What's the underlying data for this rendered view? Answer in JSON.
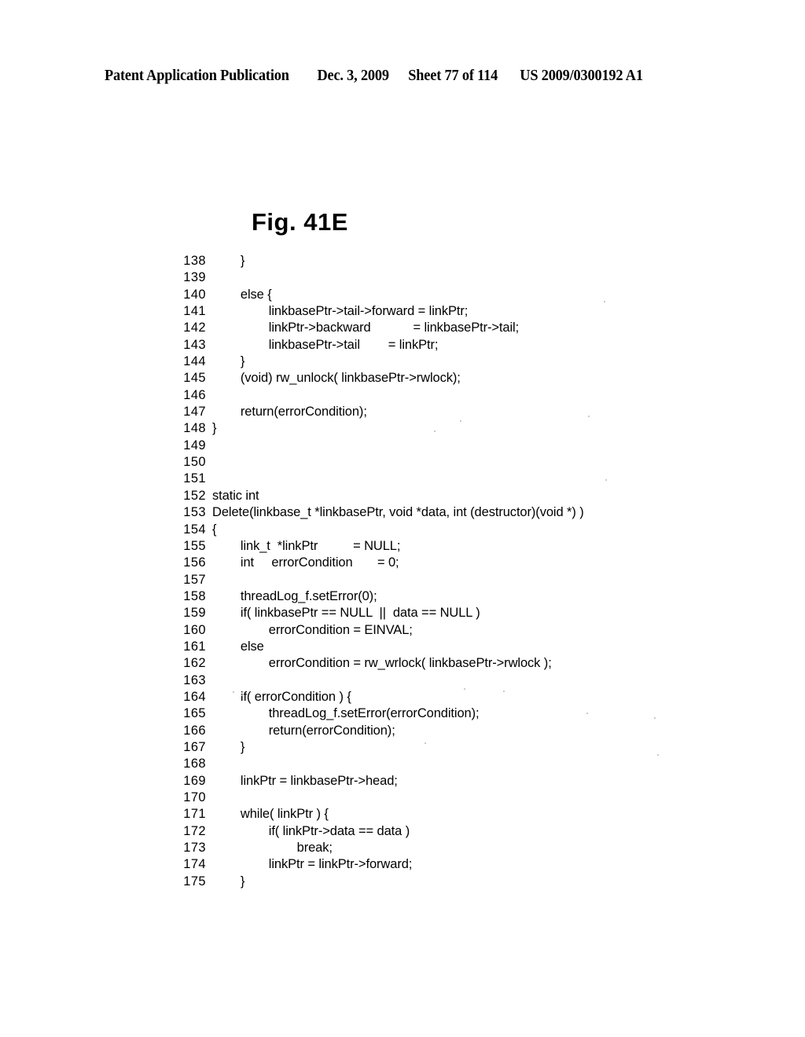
{
  "header": {
    "publication": "Patent Application Publication",
    "date": "Dec. 3, 2009",
    "sheet": "Sheet 77 of 114",
    "patent_number": "US 2009/0300192 A1"
  },
  "figure": {
    "title": "Fig. 41E"
  },
  "code": {
    "lines": [
      {
        "no": "138",
        "text": "        }"
      },
      {
        "no": "139",
        "text": ""
      },
      {
        "no": "140",
        "text": "        else {"
      },
      {
        "no": "141",
        "text": "                linkbasePtr->tail->forward = linkPtr;"
      },
      {
        "no": "142",
        "text": "                linkPtr->backward            = linkbasePtr->tail;"
      },
      {
        "no": "143",
        "text": "                linkbasePtr->tail        = linkPtr;"
      },
      {
        "no": "144",
        "text": "        }"
      },
      {
        "no": "145",
        "text": "        (void) rw_unlock( linkbasePtr->rwlock);"
      },
      {
        "no": "146",
        "text": ""
      },
      {
        "no": "147",
        "text": "        return(errorCondition);"
      },
      {
        "no": "148",
        "text": "}"
      },
      {
        "no": "149",
        "text": ""
      },
      {
        "no": "150",
        "text": ""
      },
      {
        "no": "151",
        "text": ""
      },
      {
        "no": "152",
        "text": "static int"
      },
      {
        "no": "153",
        "text": "Delete(linkbase_t *linkbasePtr, void *data, int (destructor)(void *) )"
      },
      {
        "no": "154",
        "text": "{"
      },
      {
        "no": "155",
        "text": "        link_t  *linkPtr          = NULL;"
      },
      {
        "no": "156",
        "text": "        int     errorCondition       = 0;"
      },
      {
        "no": "157",
        "text": ""
      },
      {
        "no": "158",
        "text": "        threadLog_f.setError(0);"
      },
      {
        "no": "159",
        "text": "        if( linkbasePtr == NULL  ||  data == NULL )"
      },
      {
        "no": "160",
        "text": "                errorCondition = EINVAL;"
      },
      {
        "no": "161",
        "text": "        else"
      },
      {
        "no": "162",
        "text": "                errorCondition = rw_wrlock( linkbasePtr->rwlock );"
      },
      {
        "no": "163",
        "text": ""
      },
      {
        "no": "164",
        "text": "        if( errorCondition ) {"
      },
      {
        "no": "165",
        "text": "                threadLog_f.setError(errorCondition);"
      },
      {
        "no": "166",
        "text": "                return(errorCondition);"
      },
      {
        "no": "167",
        "text": "        }"
      },
      {
        "no": "168",
        "text": ""
      },
      {
        "no": "169",
        "text": "        linkPtr = linkbasePtr->head;"
      },
      {
        "no": "170",
        "text": ""
      },
      {
        "no": "171",
        "text": "        while( linkPtr ) {"
      },
      {
        "no": "172",
        "text": "                if( linkPtr->data == data )"
      },
      {
        "no": "173",
        "text": "                        break;"
      },
      {
        "no": "174",
        "text": "                linkPtr = linkPtr->forward;"
      },
      {
        "no": "175",
        "text": "        }"
      }
    ]
  }
}
